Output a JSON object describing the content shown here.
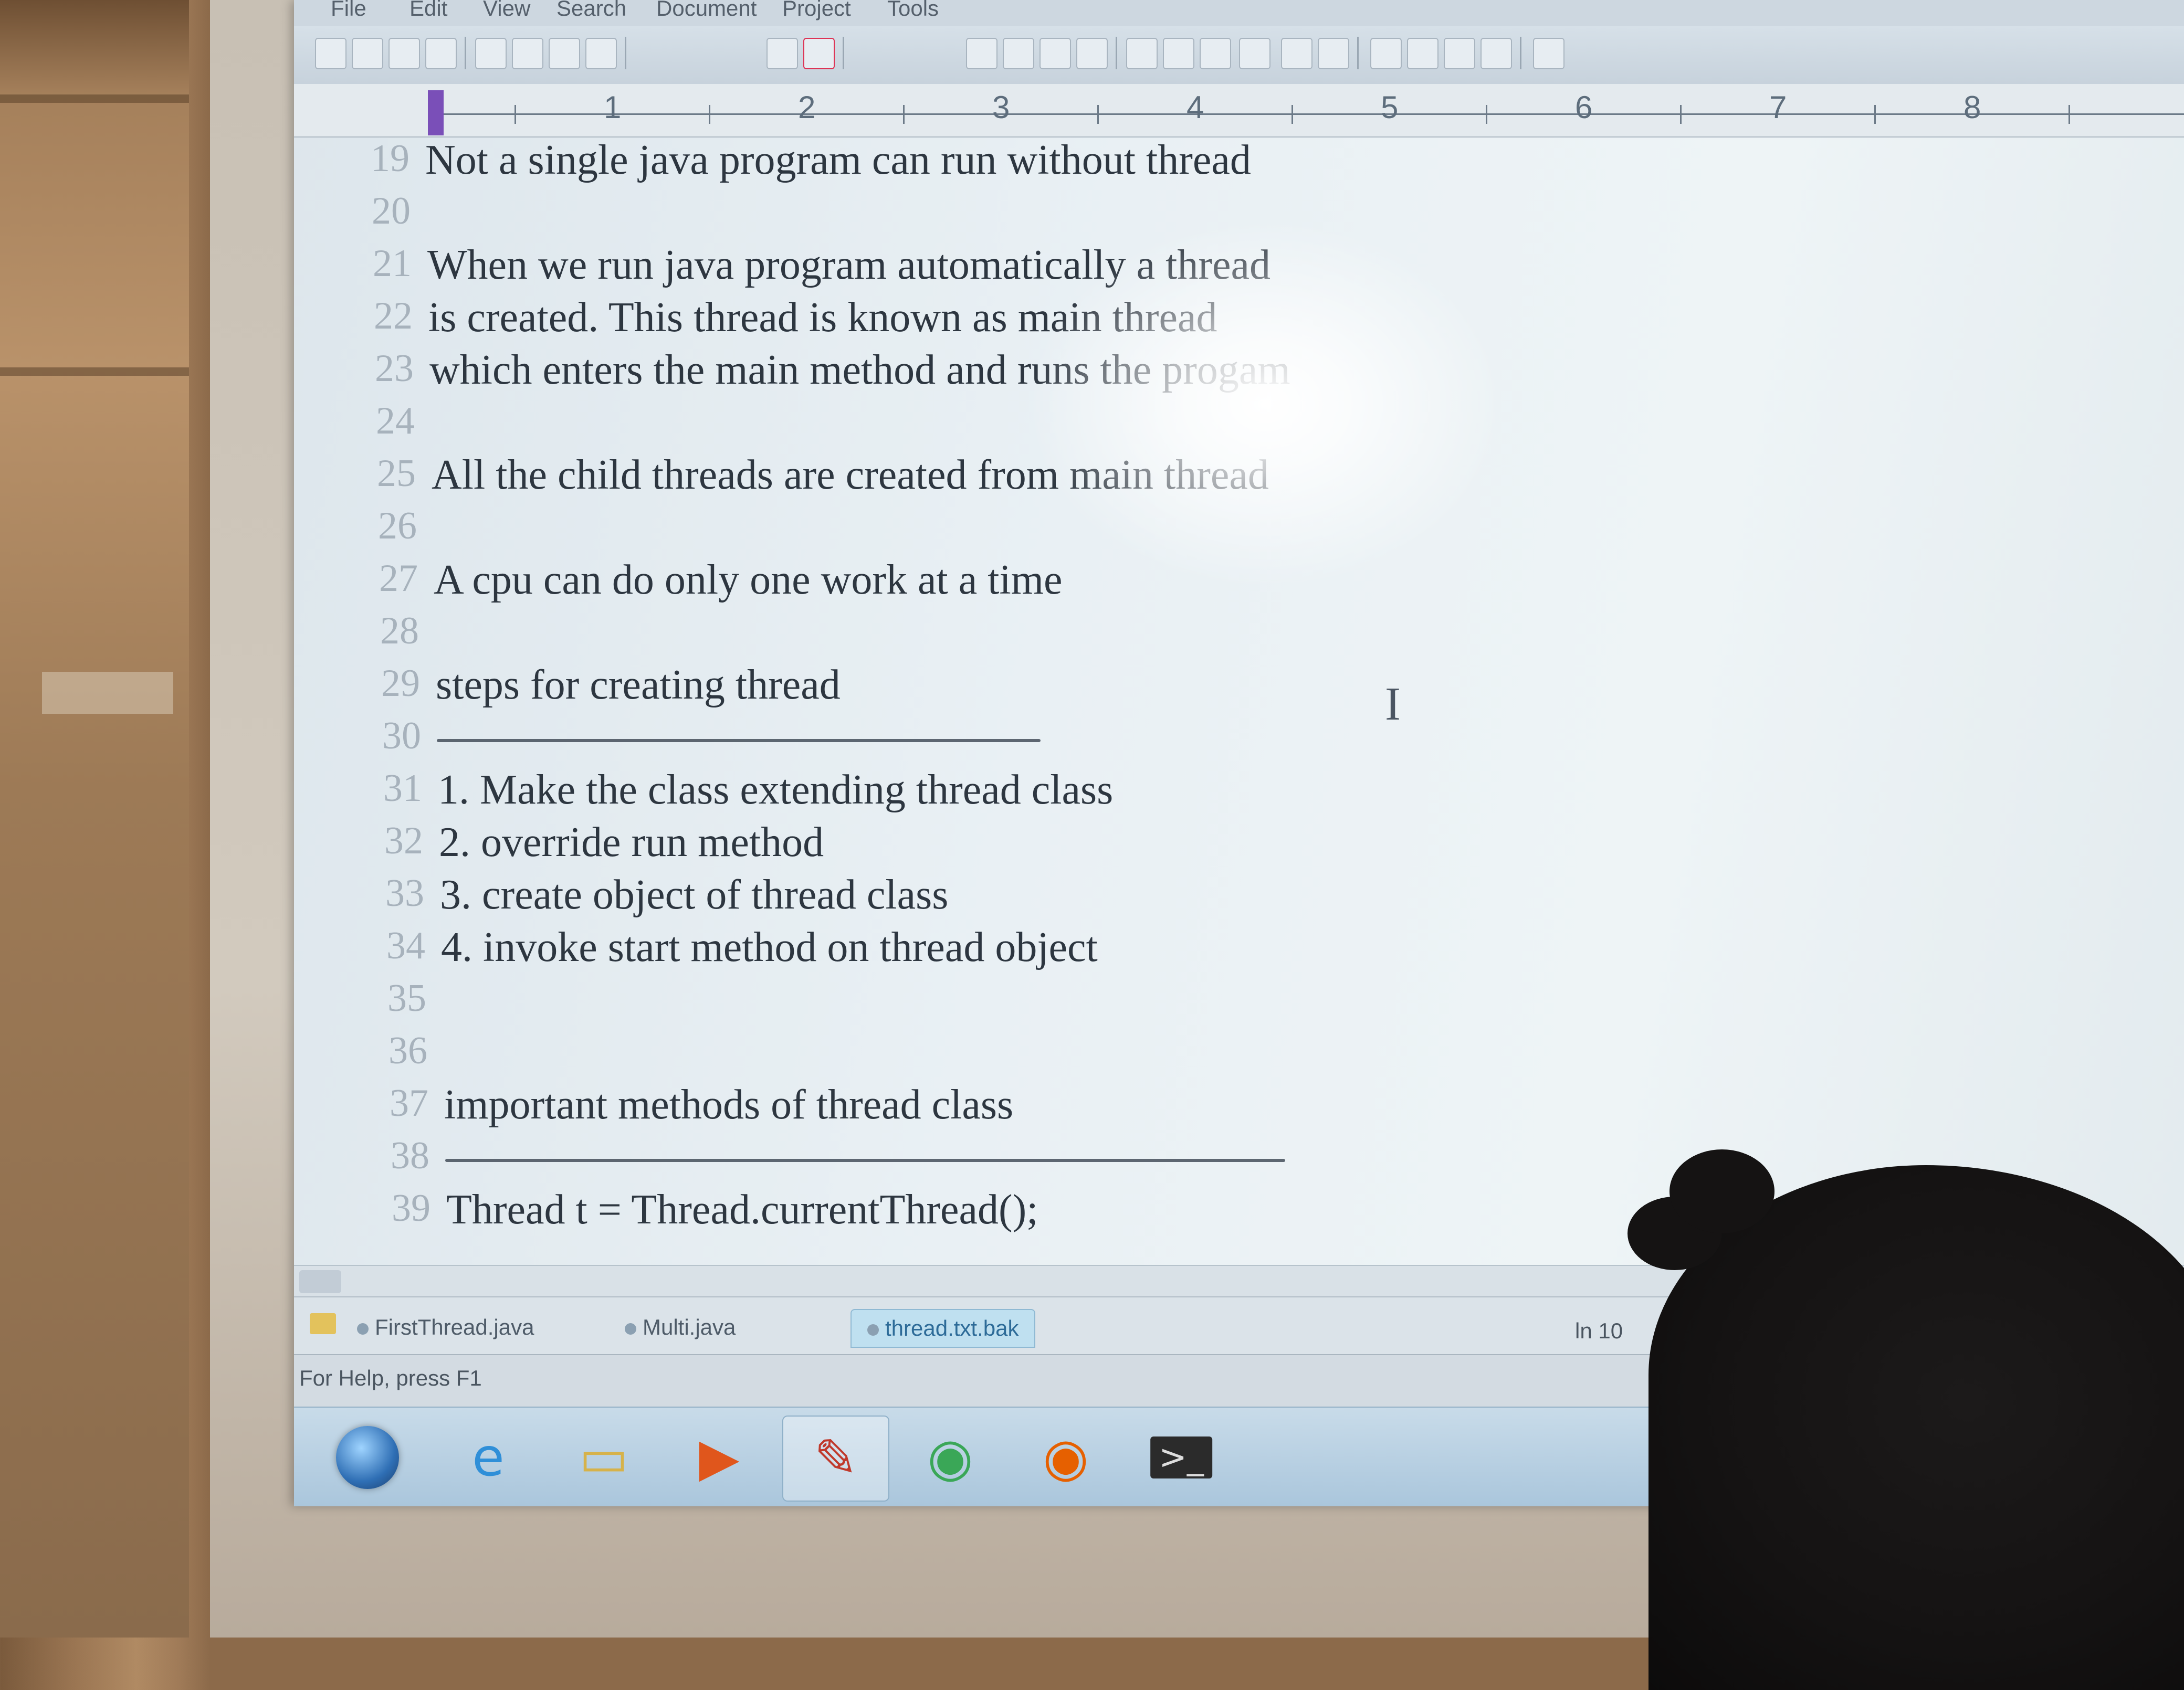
{
  "menu": [
    "File",
    "Edit",
    "View",
    "Search",
    "Document",
    "Project",
    "Tools"
  ],
  "ruler_numbers": [
    "1",
    "2",
    "3",
    "4",
    "5",
    "6",
    "7",
    "8"
  ],
  "lines": [
    {
      "num": "19",
      "text": "Not a single java program can run without thread"
    },
    {
      "num": "20",
      "text": ""
    },
    {
      "num": "21",
      "text": "When we run java program automatically a thread"
    },
    {
      "num": "22",
      "text": "is created. This thread is known as main thread"
    },
    {
      "num": "23",
      "text": "which  enters the main method and runs the progam"
    },
    {
      "num": "24",
      "text": ""
    },
    {
      "num": "25",
      "text": "All the child threads are created from main thread"
    },
    {
      "num": "26",
      "text": ""
    },
    {
      "num": "27",
      "text": "A cpu can do only one work at a time"
    },
    {
      "num": "28",
      "text": ""
    },
    {
      "num": "29",
      "text": "steps for creating thread"
    },
    {
      "num": "30",
      "text": "",
      "rule": true
    },
    {
      "num": "31",
      "text": "1. Make the class extending thread class"
    },
    {
      "num": "32",
      "text": "2. override run method"
    },
    {
      "num": "33",
      "text": "3. create object of thread class"
    },
    {
      "num": "34",
      "text": "4. invoke start method on thread object"
    },
    {
      "num": "35",
      "text": ""
    },
    {
      "num": "36",
      "text": ""
    },
    {
      "num": "37",
      "text": "important methods of thread class"
    },
    {
      "num": "38",
      "text": "",
      "rule": true
    },
    {
      "num": "39",
      "text": "Thread t = Thread.currentThread();"
    }
  ],
  "tabs": [
    {
      "label": "FirstThread.java",
      "active": false
    },
    {
      "label": "Multi.java",
      "active": false
    },
    {
      "label": "thread.txt.bak",
      "active": true
    }
  ],
  "status": {
    "help": "For Help, press F1",
    "position": "ln 10"
  },
  "taskbar": [
    {
      "name": "start",
      "glyph": ""
    },
    {
      "name": "internet-explorer",
      "glyph": "e",
      "color": "#2f8fd8"
    },
    {
      "name": "file-explorer",
      "glyph": "▭",
      "color": "#d6b24a"
    },
    {
      "name": "media-player",
      "glyph": "▶",
      "color": "#e0561c"
    },
    {
      "name": "text-editor",
      "glyph": "✎",
      "color": "#c0392b"
    },
    {
      "name": "chrome",
      "glyph": "◉",
      "color": "#3aa757"
    },
    {
      "name": "firefox",
      "glyph": "◉",
      "color": "#e66000"
    },
    {
      "name": "command-prompt",
      "glyph": ">_",
      "color": "#2b2b2b"
    }
  ]
}
